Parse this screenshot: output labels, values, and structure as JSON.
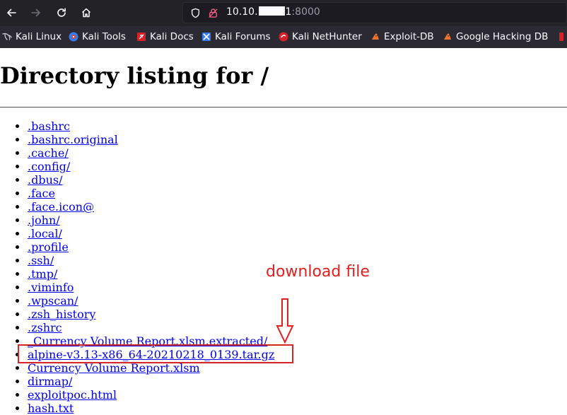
{
  "browser": {
    "url_host_prefix": "10.10.",
    "url_host_suffix": "1",
    "url_port": ":8000",
    "icons": [
      "back-arrow-icon",
      "forward-arrow-icon",
      "reload-icon",
      "home-icon",
      "shield-icon",
      "lock-icon"
    ]
  },
  "bookmarks": [
    {
      "label": "Kali Linux",
      "icon": "kali-dragon-icon"
    },
    {
      "label": "Kali Tools",
      "icon": "kali-tools-icon"
    },
    {
      "label": "Kali Docs",
      "icon": "kali-docs-icon"
    },
    {
      "label": "Kali Forums",
      "icon": "kali-forums-icon"
    },
    {
      "label": "Kali NetHunter",
      "icon": "nethunter-icon"
    },
    {
      "label": "Exploit-DB",
      "icon": "exploit-db-icon"
    },
    {
      "label": "Google Hacking DB",
      "icon": "ghdb-icon"
    }
  ],
  "page": {
    "title": "Directory listing for /",
    "entries": [
      ".bashrc",
      ".bashrc.original",
      ".cache/",
      ".config/",
      ".dbus/",
      ".face",
      ".face.icon@",
      ".john/",
      ".local/",
      ".profile",
      ".ssh/",
      ".tmp/",
      ".viminfo",
      ".wpscan/",
      ".zsh_history",
      ".zshrc",
      "_Currency Volume Report.xlsm.extracted/",
      "alpine-v3.13-x86_64-20210218_0139.tar.gz",
      "Currency Volume Report.xlsm",
      "dirmap/",
      "exploitpoc.html",
      "hash.txt"
    ]
  },
  "annotation": {
    "text": "download file",
    "color": "#e2201f"
  }
}
